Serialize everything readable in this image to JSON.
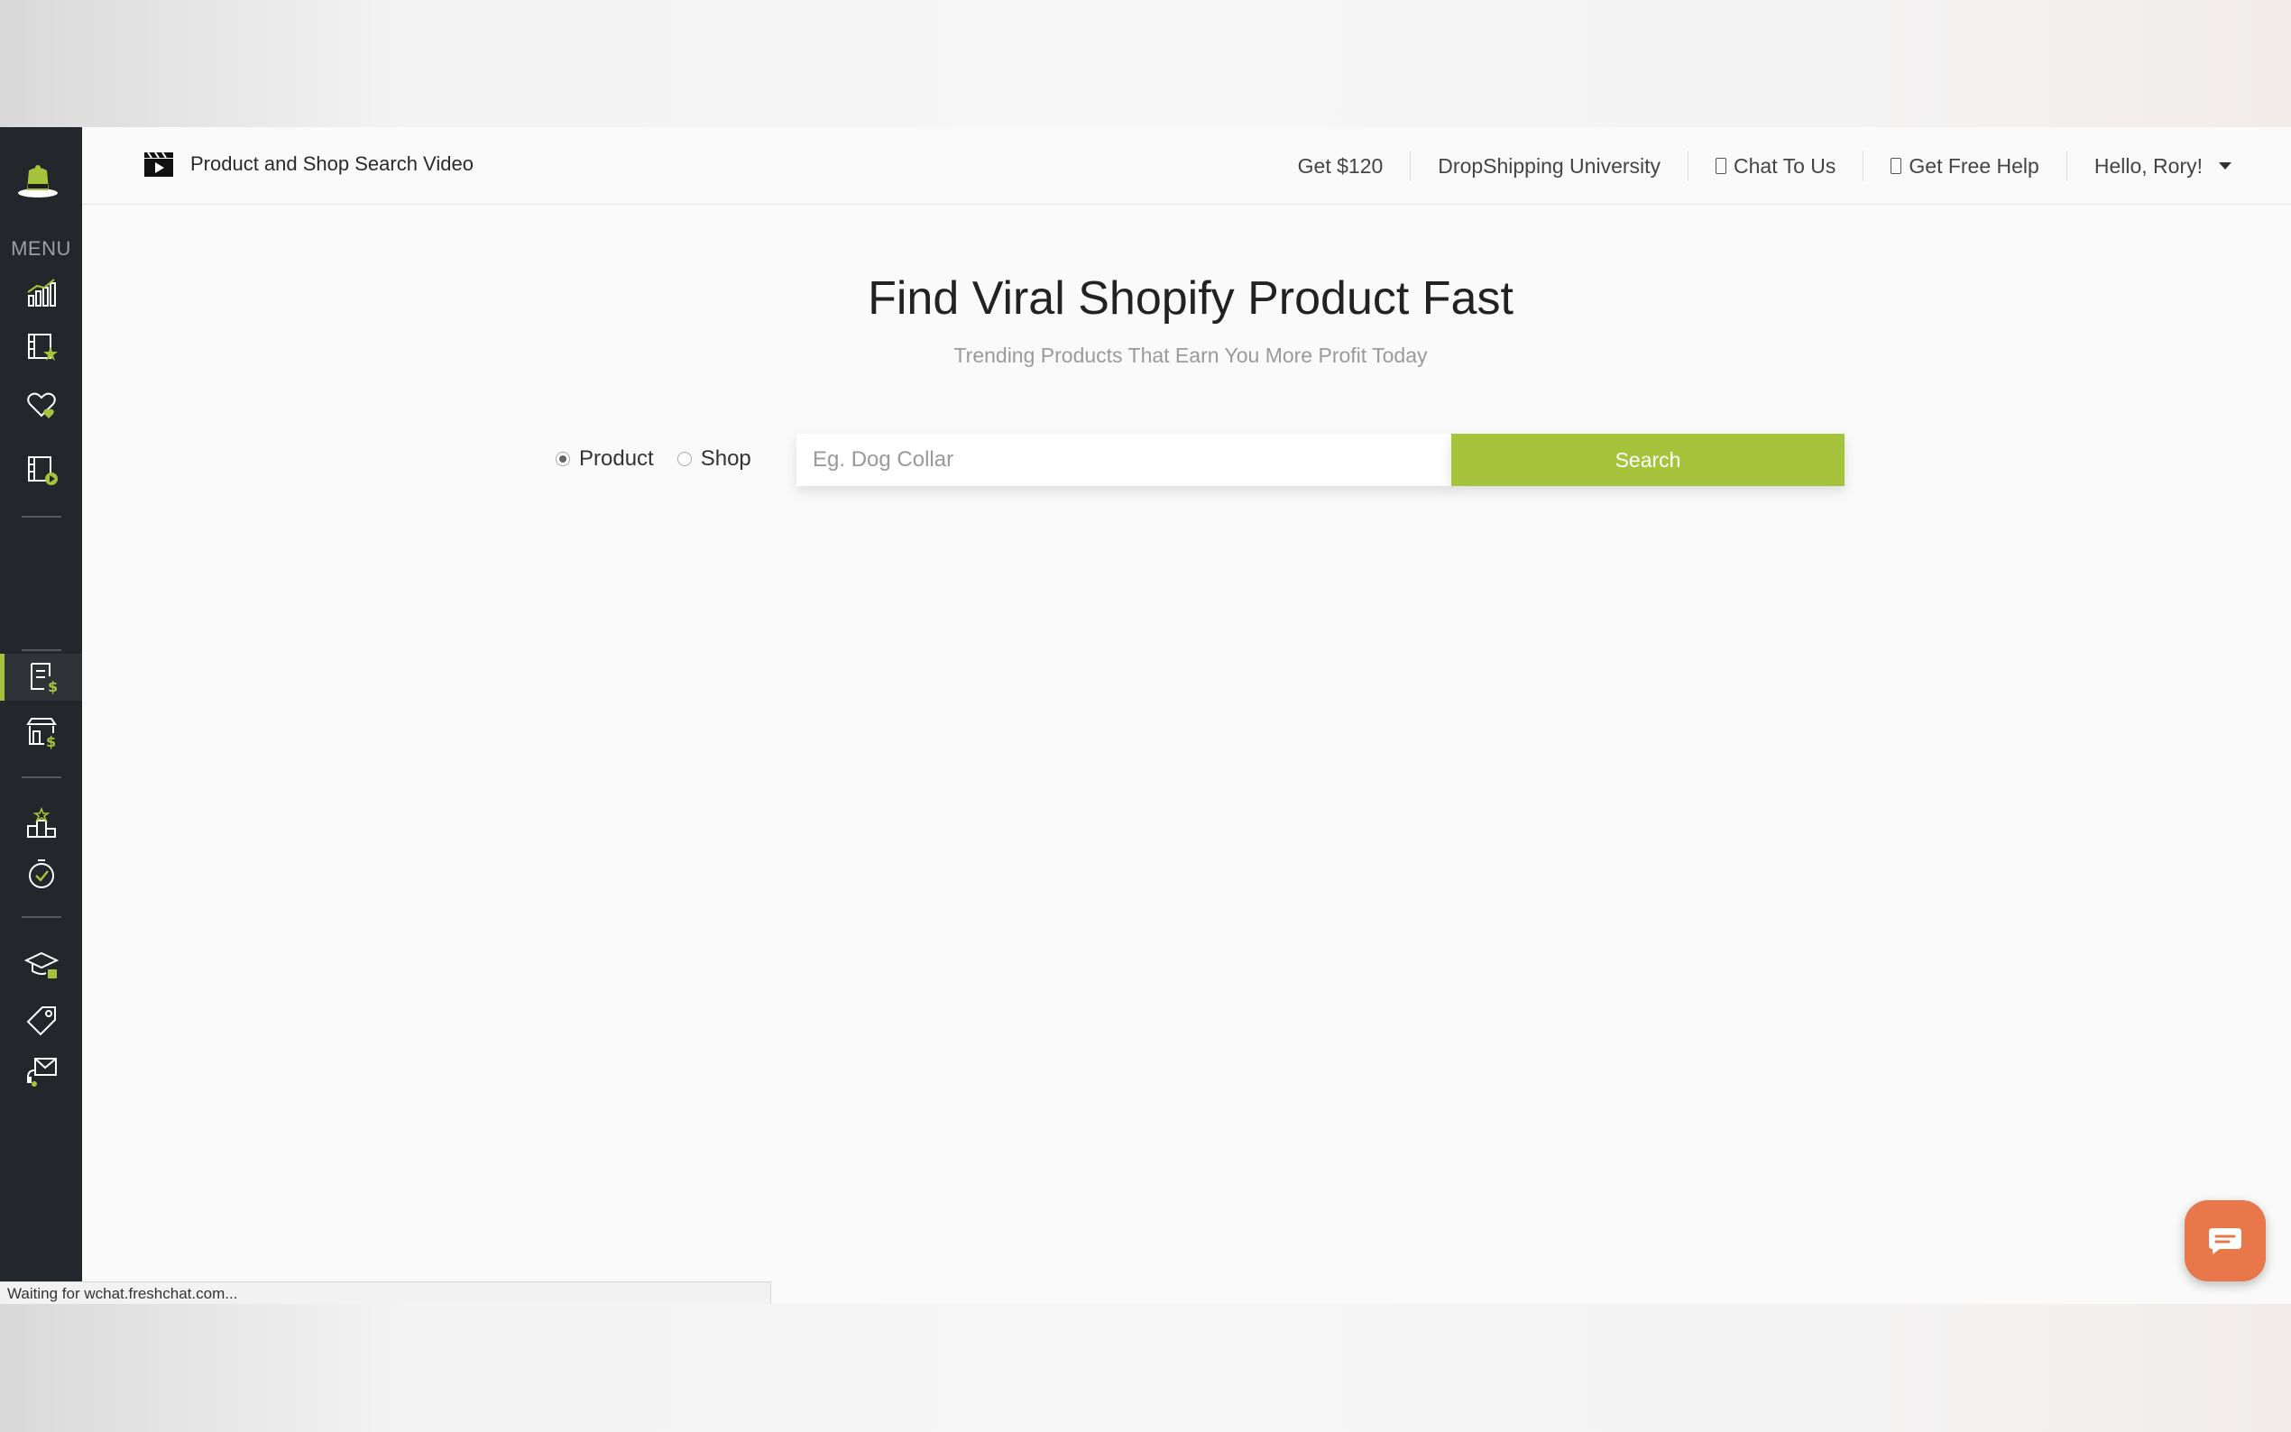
{
  "sidebar": {
    "menu_label": "MENU",
    "accent_color": "#a5c43b",
    "items": [
      {
        "icon": "chart-bars-icon"
      },
      {
        "icon": "film-star-icon"
      },
      {
        "icon": "heart-icon"
      },
      {
        "icon": "film-play-icon"
      },
      {
        "icon": "product-search-icon",
        "active": true
      },
      {
        "icon": "shop-search-icon"
      },
      {
        "icon": "ranking-podium-icon"
      },
      {
        "icon": "stopwatch-icon"
      },
      {
        "icon": "graduation-cap-icon"
      },
      {
        "icon": "price-tag-icon"
      },
      {
        "icon": "support-mail-icon"
      }
    ]
  },
  "topbar": {
    "video_link": "Product and Shop Search Video",
    "nav": {
      "get_money": "Get $120",
      "university": "DropShipping University",
      "chat": "Chat To Us",
      "help": "Get Free Help",
      "user": "Hello, Rory!"
    }
  },
  "hero": {
    "title": "Find Viral Shopify Product Fast",
    "subtitle": "Trending Products That Earn You More Profit Today"
  },
  "search": {
    "radio_product": "Product",
    "radio_shop": "Shop",
    "selected": "Product",
    "placeholder": "Eg. Dog Collar",
    "button": "Search"
  },
  "status_bar": "Waiting for wchat.freshchat.com...",
  "chat_widget": {
    "icon": "chat-bubble-icon",
    "color": "#e8774a"
  }
}
